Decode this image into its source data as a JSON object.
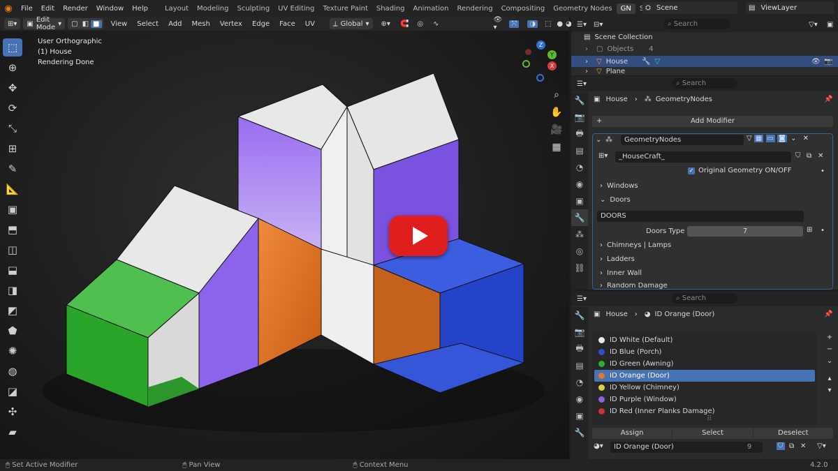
{
  "menubar": {
    "items": [
      "File",
      "Edit",
      "Render",
      "Window",
      "Help"
    ],
    "workspaces": [
      "Layout",
      "Modeling",
      "Sculpting",
      "UV Editing",
      "Texture Paint",
      "Shading",
      "Animation",
      "Rendering",
      "Compositing",
      "Geometry Nodes",
      "GN",
      "Scripti"
    ],
    "active_workspace": "GN",
    "scene": "Scene",
    "view_layer": "ViewLayer"
  },
  "viewport_header": {
    "mode": "Edit Mode",
    "menus": [
      "View",
      "Select",
      "Add",
      "Mesh",
      "Vertex",
      "Edge",
      "Face",
      "UV"
    ],
    "orientation": "Global"
  },
  "viewport": {
    "view_name": "User Orthographic",
    "object": "(1) House",
    "status": "Rendering Done",
    "gizmo_axes": [
      "Z",
      "Y",
      "X"
    ]
  },
  "outliner": {
    "search_placeholder": "Search",
    "root": "Scene Collection",
    "items": [
      "Objects",
      "House",
      "Plane"
    ],
    "objects_count": "4"
  },
  "modifier_panel": {
    "search_placeholder": "Search",
    "breadcrumb_object": "House",
    "breadcrumb_modifier": "GeometryNodes",
    "add_modifier": "Add Modifier",
    "modifier_name": "GeometryNodes",
    "node_group": "_HouseCraft_",
    "checkbox_label": "Original Geometry ON/OFF",
    "sections": [
      "Windows",
      "Doors"
    ],
    "doors_label": "DOORS",
    "doors_type_label": "Doors Type",
    "doors_type_value": "7",
    "more_sections": [
      "Chimneys | Lamps",
      "Ladders",
      "Inner Wall",
      "Random Damage"
    ]
  },
  "material_panel": {
    "search_placeholder": "Search",
    "breadcrumb_object": "House",
    "breadcrumb_material": "ID Orange (Door)",
    "slots": [
      {
        "name": "ID White (Default)",
        "color": "#e8e8e8"
      },
      {
        "name": "ID Blue (Porch)",
        "color": "#2d4fd0"
      },
      {
        "name": "ID Green (Awning)",
        "color": "#2fae2f"
      },
      {
        "name": "ID Orange (Door)",
        "color": "#e07a2a"
      },
      {
        "name": "ID Yellow (Chimney)",
        "color": "#e0d040"
      },
      {
        "name": "ID Purple (Window)",
        "color": "#8a62e6"
      },
      {
        "name": "ID Red (Inner Planks Damage)",
        "color": "#d03030"
      }
    ],
    "selected_slot": "ID Orange (Door)",
    "assign": "Assign",
    "select": "Select",
    "deselect": "Deselect",
    "material_name": "ID Orange (Door)",
    "users": "9"
  },
  "statusbar": {
    "left": "Set Active Modifier",
    "mid": "Pan View",
    "right": "Context Menu",
    "version": "4.2.0"
  },
  "colors": {
    "accent": "#4772b3",
    "purple": "#8a62e6",
    "orange": "#e07a2a",
    "blue": "#2d4fd0",
    "green": "#2fae2f"
  }
}
